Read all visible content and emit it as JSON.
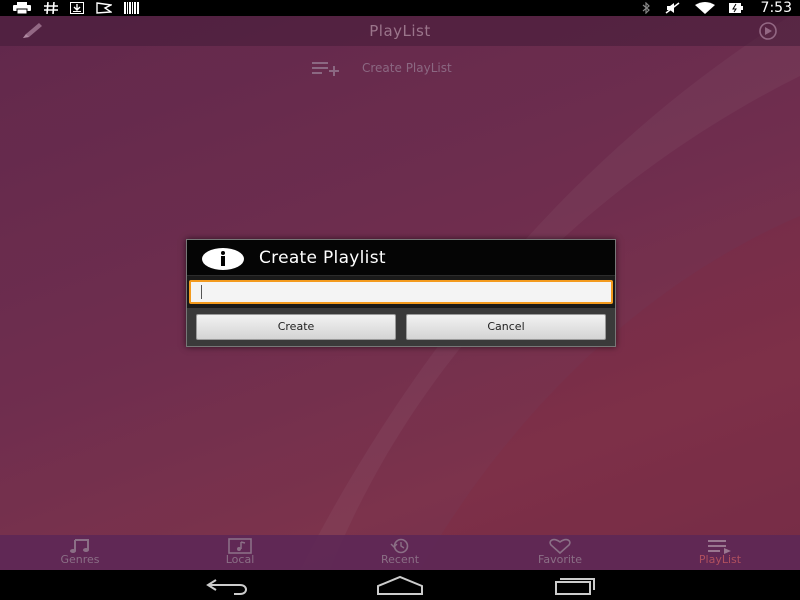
{
  "status_bar": {
    "icons": [
      "printer-icon",
      "hashtag-icon",
      "download-icon",
      "flag-icon",
      "barcode-icon",
      "bluetooth-icon",
      "mute-icon",
      "wifi-icon",
      "battery-icon"
    ],
    "time": "7:53"
  },
  "header": {
    "title": "PlayList",
    "left_icon": "pencil-icon",
    "right_icon": "play-circle-icon"
  },
  "create_row": {
    "icon": "playlist-add-icon",
    "label": "Create PlayList"
  },
  "dialog": {
    "title": "Create Playlist",
    "icon": "info-icon",
    "input_value": "",
    "create_label": "Create",
    "cancel_label": "Cancel",
    "focus_color": "#f39a1e"
  },
  "tabs": [
    {
      "label": "Genres",
      "icon": "music-note-icon",
      "active": false
    },
    {
      "label": "Local",
      "icon": "local-music-icon",
      "active": false
    },
    {
      "label": "Recent",
      "icon": "history-icon",
      "active": false
    },
    {
      "label": "Favorite",
      "icon": "heart-icon",
      "active": false
    },
    {
      "label": "PlayList",
      "icon": "playlist-icon",
      "active": true
    }
  ],
  "nav": {
    "icons": [
      "back-icon",
      "home-icon",
      "recents-icon"
    ]
  },
  "colors": {
    "accent": "#b0505e",
    "background": "#7a3357"
  }
}
